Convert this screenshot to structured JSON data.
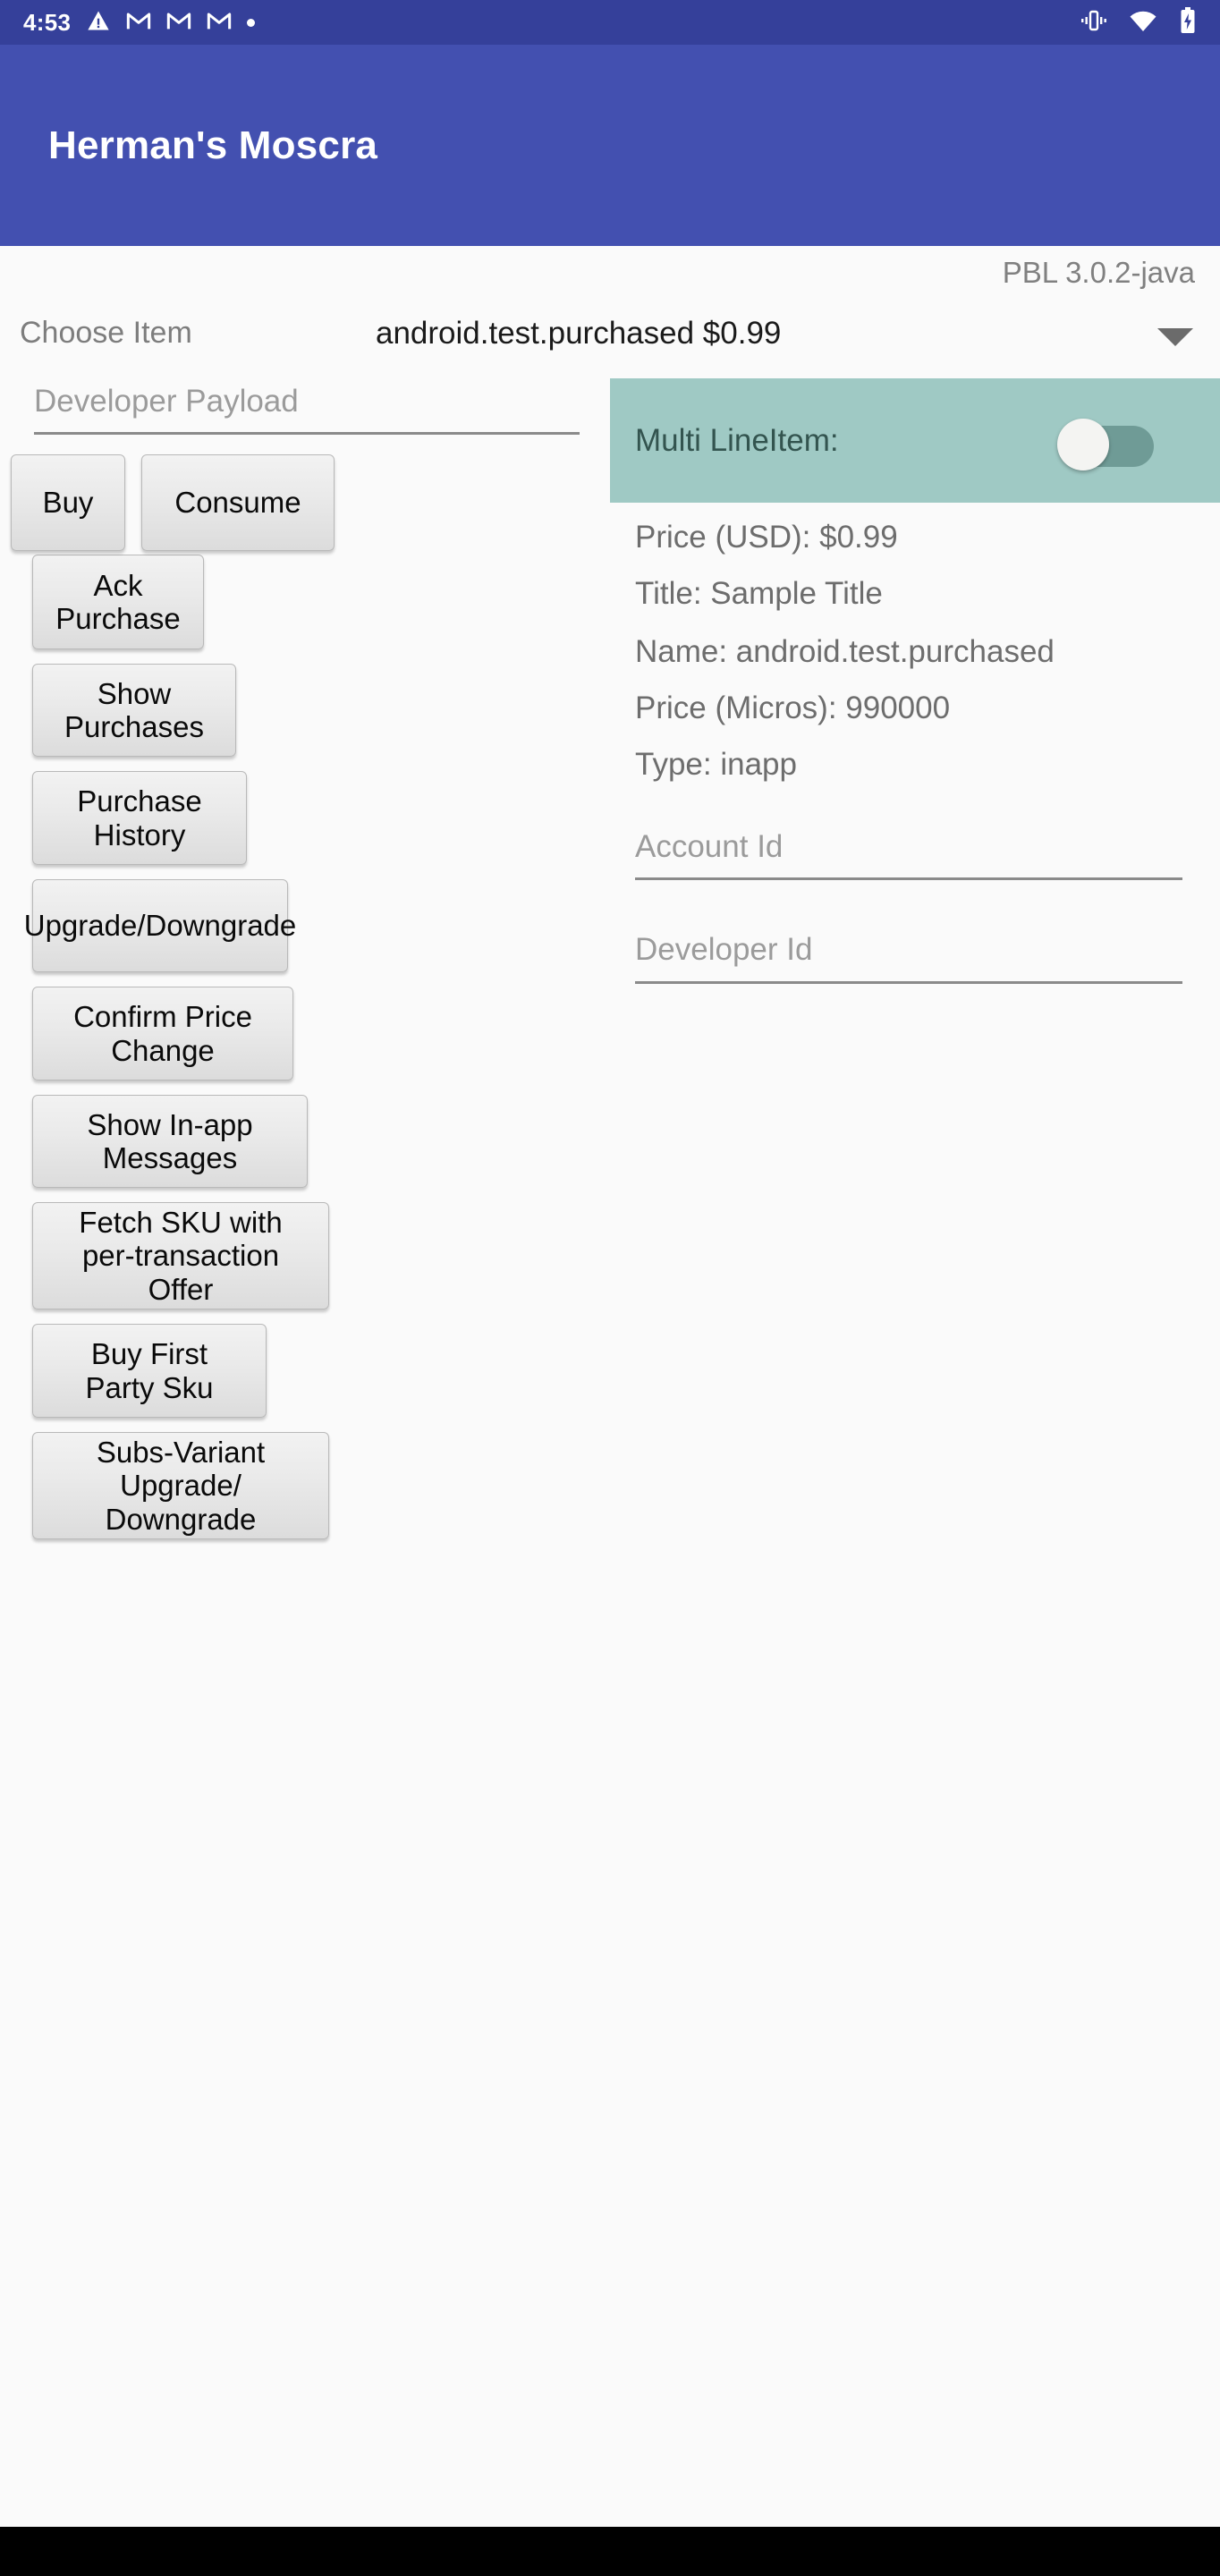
{
  "status_bar": {
    "time": "4:53",
    "left_icons": [
      {
        "name": "warning-triangle-icon",
        "glyph": "warning"
      },
      {
        "name": "gmail-icon-1",
        "glyph": "gmail"
      },
      {
        "name": "gmail-icon-2",
        "glyph": "gmail"
      },
      {
        "name": "gmail-icon-3",
        "glyph": "gmail"
      },
      {
        "name": "overflow-dot-icon",
        "glyph": "dot"
      }
    ],
    "right_icons": [
      {
        "name": "vibrate-icon",
        "glyph": "vibrate"
      },
      {
        "name": "wifi-icon",
        "glyph": "wifi"
      },
      {
        "name": "battery-charging-icon",
        "glyph": "battery-charging"
      }
    ],
    "background_color": "#35409A"
  },
  "app_bar": {
    "title": "Herman's Moscra",
    "background_color": "#4350B0",
    "text_color": "#FFFFFF"
  },
  "header": {
    "version": "PBL 3.0.2-java"
  },
  "spinner": {
    "label": "Choose Item",
    "selected_value": "android.test.purchased $0.99",
    "caret_icon": "chevron-down-icon"
  },
  "left_column": {
    "payload_input": {
      "placeholder": "Developer Payload",
      "value": ""
    },
    "buttons": [
      {
        "id": "buy",
        "label": "Buy"
      },
      {
        "id": "consume",
        "label": "Consume"
      },
      {
        "id": "ack-purchase",
        "label": "Ack Purchase"
      },
      {
        "id": "show-purchases",
        "label": "Show Purchases"
      },
      {
        "id": "purchase-history",
        "label": "Purchase History"
      },
      {
        "id": "upgrade-downgrade",
        "label": "Upgrade/Downgrade"
      },
      {
        "id": "confirm-price-change",
        "label": "Confirm Price Change"
      },
      {
        "id": "show-inapp-messages",
        "label": "Show In-app Messages"
      },
      {
        "id": "fetch-sku-offer",
        "label": "Fetch SKU with\nper-transaction Offer"
      },
      {
        "id": "buy-first-party-sku",
        "label": "Buy First Party Sku"
      },
      {
        "id": "subs-variant-upgrade",
        "label": "Subs-Variant Upgrade/\nDowngrade"
      }
    ]
  },
  "right_column": {
    "multi_lineitem": {
      "label": "Multi LineItem:",
      "switch_state": "off",
      "panel_color": "#9FC9C4",
      "track_color": "#6F9B96",
      "thumb_color": "#F4F4F2",
      "label_color": "#33544F"
    },
    "details": [
      {
        "id": "price-usd",
        "text": "Price (USD): $0.99"
      },
      {
        "id": "title",
        "text": "Title: Sample Title"
      },
      {
        "id": "name",
        "text": "Name: android.test.purchased"
      },
      {
        "id": "price-micros",
        "text": "Price (Micros): 990000"
      },
      {
        "id": "type",
        "text": "Type: inapp"
      }
    ],
    "account_id_input": {
      "placeholder": "Account Id",
      "value": ""
    },
    "developer_id_input": {
      "placeholder": "Developer Id",
      "value": ""
    }
  },
  "nav_bar": {
    "background_color": "#000000"
  }
}
